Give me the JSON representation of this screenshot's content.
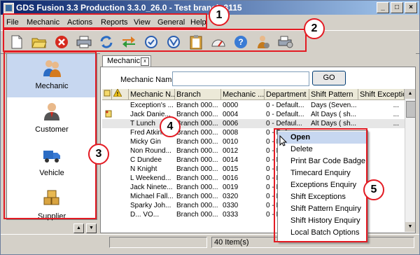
{
  "window": {
    "title": "GDS Fusion 3.3 Production 3.3.0_26.0 - Test branch 3115",
    "controls": [
      "_",
      "□",
      "×"
    ]
  },
  "menu": [
    "File",
    "Mechanic",
    "Actions",
    "Reports",
    "View",
    "General",
    "Help"
  ],
  "toolbar": {
    "icons": [
      "new-document-icon",
      "open-folder-icon",
      "delete-icon",
      "print-icon",
      "refresh-icon",
      "transfer-icon",
      "checklist-icon",
      "approve-icon",
      "clipboard-icon",
      "gauge-icon",
      "help-icon",
      "user-settings-icon",
      "printer-settings-icon"
    ]
  },
  "sidebar": {
    "items": [
      {
        "label": "Mechanic",
        "icon": "mechanic-icon",
        "selected": true
      },
      {
        "label": "Customer",
        "icon": "customer-icon",
        "selected": false
      },
      {
        "label": "Vehicle",
        "icon": "vehicle-icon",
        "selected": false
      },
      {
        "label": "Supplier",
        "icon": "supplier-icon",
        "selected": false
      }
    ],
    "scroll_up": "▲",
    "scroll_down": "▼"
  },
  "tab": {
    "label": "Mechanic"
  },
  "search": {
    "label": "Mechanic Name",
    "value": "",
    "button": "GO"
  },
  "grid": {
    "columns": [
      "Mechanic N...",
      "Branch",
      "Mechanic ...",
      "Department",
      "Shift Pattern",
      "Shift Exception"
    ],
    "rows": [
      {
        "name": "Exception's ...",
        "branch": "Branch 000...",
        "code": "0000",
        "dept": "0 - Default...",
        "shift": "Days (Seven...",
        "exc": "...",
        "note": false,
        "sel": false
      },
      {
        "name": "Jack Danie...",
        "branch": "Branch 000...",
        "code": "0004",
        "dept": "0 - Default...",
        "shift": "Alt Days ( sh...",
        "exc": "...",
        "note": true,
        "sel": false
      },
      {
        "name": "T Lunch",
        "branch": "Branch 000...",
        "code": "0006",
        "dept": "0 - Defaul...",
        "shift": "Alt Days ( sh...",
        "exc": "...",
        "note": false,
        "sel": true
      },
      {
        "name": "Fred Atkins...",
        "branch": "Branch 000...",
        "code": "0008",
        "dept": "0 - Def...",
        "shift": "",
        "exc": "",
        "note": false,
        "sel": false
      },
      {
        "name": "Micky Gin",
        "branch": "Branch 000...",
        "code": "0010",
        "dept": "0 - Def...",
        "shift": "",
        "exc": "",
        "note": false,
        "sel": false
      },
      {
        "name": "Non Round...",
        "branch": "Branch 000...",
        "code": "0012",
        "dept": "0 - Def...",
        "shift": "",
        "exc": "",
        "note": false,
        "sel": false
      },
      {
        "name": "C Dundee",
        "branch": "Branch 000...",
        "code": "0014",
        "dept": "0 - Def...",
        "shift": "",
        "exc": "",
        "note": false,
        "sel": false
      },
      {
        "name": "N Knight",
        "branch": "Branch 000...",
        "code": "0015",
        "dept": "0 - Def...",
        "shift": "",
        "exc": "",
        "note": false,
        "sel": false
      },
      {
        "name": "L Weekend...",
        "branch": "Branch 000...",
        "code": "0016",
        "dept": "0 - Def...",
        "shift": "",
        "exc": "",
        "note": false,
        "sel": false
      },
      {
        "name": "Jack Ninete...",
        "branch": "Branch 000...",
        "code": "0019",
        "dept": "0 - Def...",
        "shift": "",
        "exc": "",
        "note": false,
        "sel": false
      },
      {
        "name": "Michael Fall...",
        "branch": "Branch 000...",
        "code": "0320",
        "dept": "0 - Def...",
        "shift": "",
        "exc": "",
        "note": false,
        "sel": false
      },
      {
        "name": "Sparky Joh...",
        "branch": "Branch 000...",
        "code": "0330",
        "dept": "0 - Def...",
        "shift": "",
        "exc": "",
        "note": false,
        "sel": false
      },
      {
        "name": "D... VO...",
        "branch": "Branch 000...",
        "code": "0333",
        "dept": "0 - Def...",
        "shift": "",
        "exc": "",
        "note": false,
        "sel": false
      }
    ]
  },
  "context_menu": {
    "items": [
      {
        "label": "Open",
        "highlighted": true
      },
      {
        "label": "Delete",
        "highlighted": false
      },
      {
        "label": "Print Bar Code Badge",
        "highlighted": false
      },
      {
        "label": "Timecard Enquiry",
        "highlighted": false
      },
      {
        "label": "Exceptions Enquiry",
        "highlighted": false
      },
      {
        "label": "Shift Exceptions",
        "highlighted": false
      },
      {
        "label": "Shift Pattern Enquiry",
        "highlighted": false
      },
      {
        "label": "Shift History Enquiry",
        "highlighted": false
      },
      {
        "label": "Local Batch Options",
        "highlighted": false
      }
    ]
  },
  "status": {
    "items_count": "40 Item(s)"
  },
  "callouts": [
    "1",
    "2",
    "3",
    "4",
    "5"
  ],
  "colors": {
    "callout_red": "#e31b23",
    "title_blue": "#0a246a",
    "selection": "#c7d7f0"
  }
}
